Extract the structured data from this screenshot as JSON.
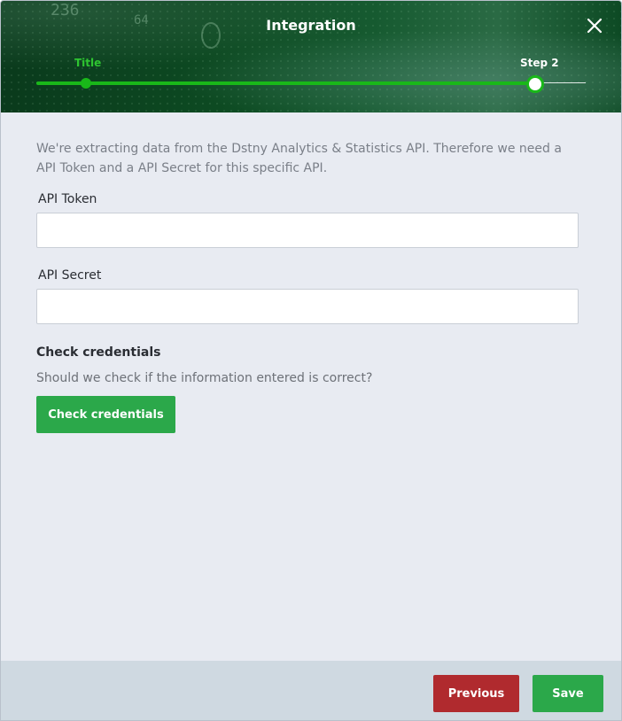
{
  "dialog": {
    "title": "Integration",
    "close_label": "×"
  },
  "stepper": {
    "steps": [
      {
        "label": "Title",
        "state": "completed"
      },
      {
        "label": "Step 2",
        "state": "current"
      }
    ],
    "progress": 0.9
  },
  "form": {
    "intro": "We're extracting data from the Dstny Analytics & Statistics API. Therefore we need a API Token and a API Secret for this specific API.",
    "api_token": {
      "label": "API Token",
      "value": "",
      "placeholder": ""
    },
    "api_secret": {
      "label": "API Secret",
      "value": "",
      "placeholder": ""
    },
    "check": {
      "title": "Check credentials",
      "description": "Should we check if the information entered is correct?",
      "button_label": "Check credentials"
    }
  },
  "footer": {
    "previous_label": "Previous",
    "save_label": "Save"
  },
  "colors": {
    "accent_green": "#2ba84a",
    "stepper_green": "#19b819",
    "danger_red": "#b02a2e",
    "header_dark": "#0d4a22"
  },
  "icons": {
    "close": "close-icon"
  }
}
